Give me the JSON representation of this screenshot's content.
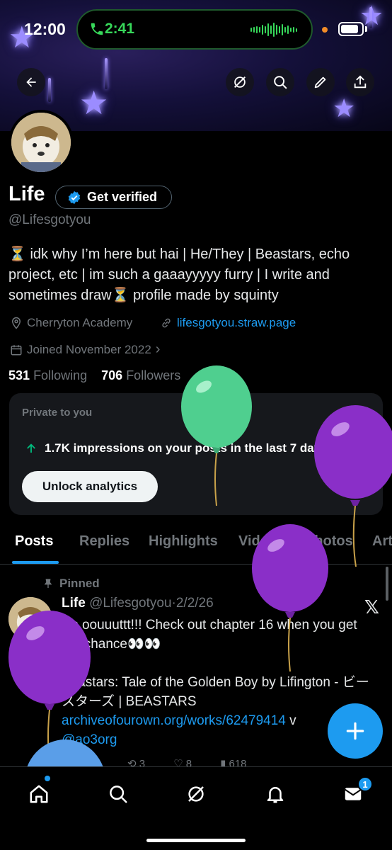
{
  "status_bar": {
    "time": "12:00",
    "call_time": "2:41"
  },
  "profile": {
    "name": "Life",
    "get_verified_label": "Get verified",
    "handle": "@Lifesgotyou",
    "bio": "⏳ idk why I’m here but hai | He/They | Beastars, echo project, etc | im such a gaaayyyyy furry | I write and sometimes draw⏳ profile made by squinty",
    "location": "Cherryton Academy",
    "website": "lifesgotyou.straw.page",
    "joined": "Joined November 2022",
    "following_count": "531",
    "following_label": "Following",
    "followers_count": "706",
    "followers_label": "Followers"
  },
  "analytics": {
    "private_label": "Private to you",
    "impressions_text": "1.7K impressions on your posts in the last 7 days",
    "unlock_label": "Unlock analytics"
  },
  "tabs": [
    {
      "label": "Posts"
    },
    {
      "label": "Replies"
    },
    {
      "label": "Highlights"
    },
    {
      "label": "Videos"
    },
    {
      "label": "Photos"
    },
    {
      "label": "Art"
    }
  ],
  "pinned_post": {
    "pinned_label": "Pinned",
    "author_name": "Life",
    "author_handle": "@Lifesgotyou",
    "date": "2/2/26",
    "line1": "It's oouuuttt!!! Check out chapter 16 when you get the chance👀👀",
    "line2": "Beastars: Tale of the Golden Boy by Lifington - ビースターズ | BEASTARS",
    "link": "archiveofourown.org/works/62479414",
    "link_suffix": "v",
    "mention": "@ao3org",
    "retweets": "3",
    "likes": "8",
    "views": "618"
  },
  "colors": {
    "accent": "#1d9bf0",
    "call_green": "#37d85a"
  }
}
